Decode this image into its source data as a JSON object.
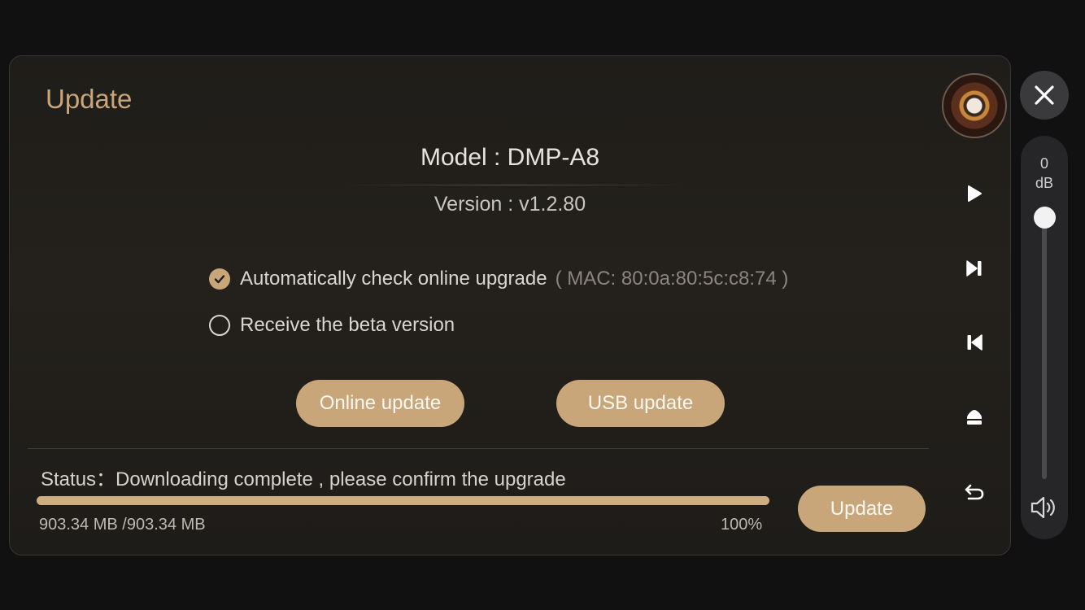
{
  "dialog": {
    "title": "Update",
    "model": "Model : DMP-A8",
    "version": "Version : v1.2.80",
    "options": {
      "auto_check_label": "Automatically check online upgrade",
      "auto_check_checked": true,
      "mac_text": "( MAC: 80:0a:80:5c:c8:74 )",
      "beta_label": "Receive the beta version",
      "beta_checked": false
    },
    "buttons": {
      "online_update": "Online update",
      "usb_update": "USB update",
      "update": "Update"
    },
    "status": {
      "text": "Status：Downloading complete , please confirm the upgrade",
      "size": "903.34 MB /903.34 MB",
      "percent_text": "100%",
      "progress": 1.0
    }
  },
  "player": {
    "album_art": "album-cover",
    "controls": [
      "play-icon",
      "next-track-icon",
      "previous-track-icon",
      "eject-icon",
      "back-icon"
    ]
  },
  "volume": {
    "value": "0",
    "unit": "dB",
    "level": 1.0
  },
  "colors": {
    "accent": "#c9a67a",
    "title": "#c8a67a",
    "background": "#111112",
    "panel": "#22201b"
  }
}
